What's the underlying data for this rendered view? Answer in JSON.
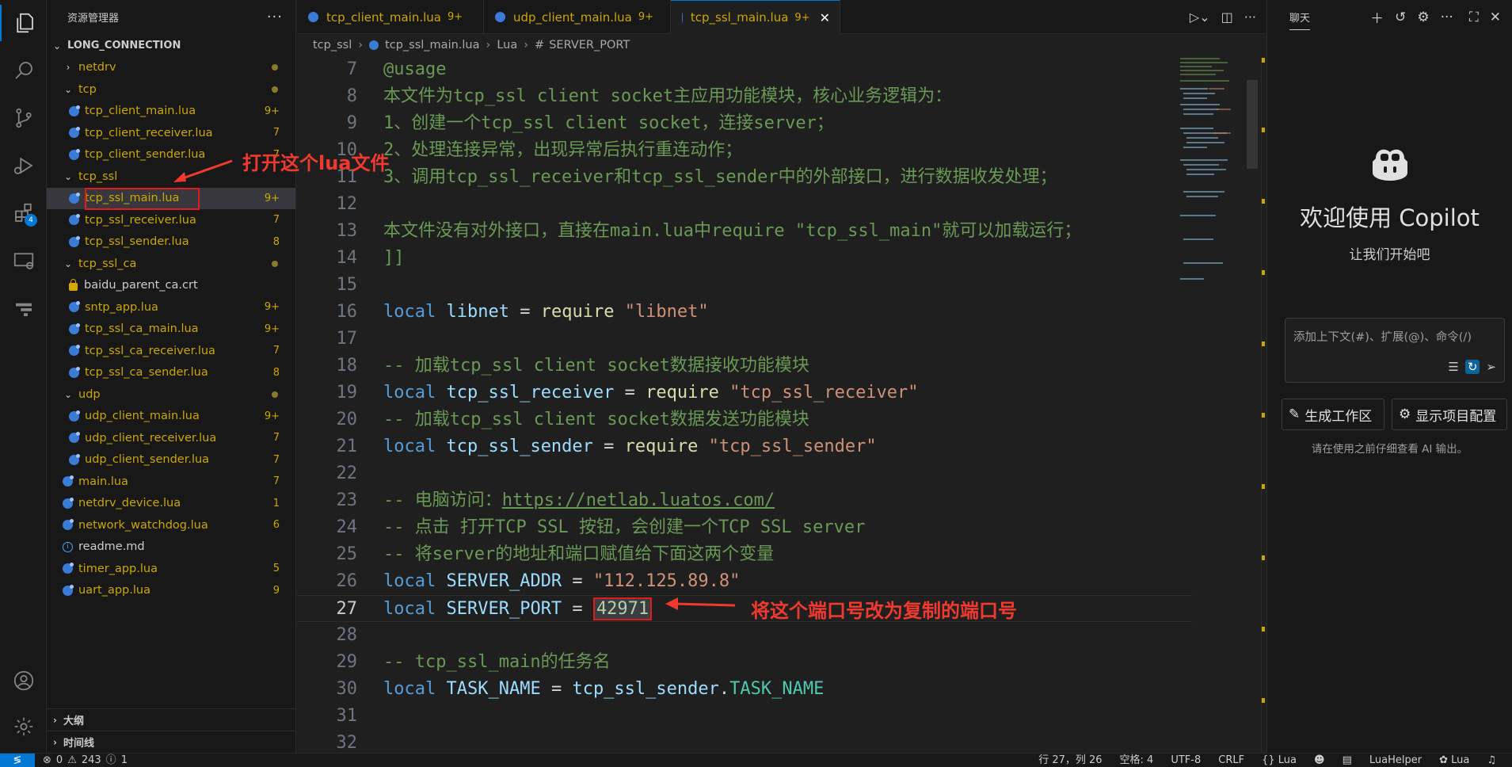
{
  "explorer": {
    "title": "资源管理器",
    "more": "···",
    "root": "LONG_CONNECTION",
    "items": [
      {
        "label": "netdrv",
        "kind": "folder",
        "level": 1,
        "status": "dot"
      },
      {
        "label": "tcp",
        "kind": "folder-open",
        "level": 1,
        "status": "dot"
      },
      {
        "label": "tcp_client_main.lua",
        "kind": "lua",
        "level": 2,
        "status": "9+"
      },
      {
        "label": "tcp_client_receiver.lua",
        "kind": "lua",
        "level": 2,
        "status": "7"
      },
      {
        "label": "tcp_client_sender.lua",
        "kind": "lua",
        "level": 2,
        "status": "7"
      },
      {
        "label": "tcp_ssl",
        "kind": "folder-open",
        "level": 1,
        "status": ""
      },
      {
        "label": "tcp_ssl_main.lua",
        "kind": "lua",
        "level": 2,
        "status": "9+",
        "selected": true
      },
      {
        "label": "tcp_ssl_receiver.lua",
        "kind": "lua",
        "level": 2,
        "status": "7"
      },
      {
        "label": "tcp_ssl_sender.lua",
        "kind": "lua",
        "level": 2,
        "status": "8"
      },
      {
        "label": "tcp_ssl_ca",
        "kind": "folder-open",
        "level": 1,
        "status": "dot"
      },
      {
        "label": "baidu_parent_ca.crt",
        "kind": "crt",
        "level": 2,
        "status": ""
      },
      {
        "label": "sntp_app.lua",
        "kind": "lua",
        "level": 2,
        "status": "9+"
      },
      {
        "label": "tcp_ssl_ca_main.lua",
        "kind": "lua",
        "level": 2,
        "status": "9+"
      },
      {
        "label": "tcp_ssl_ca_receiver.lua",
        "kind": "lua",
        "level": 2,
        "status": "7"
      },
      {
        "label": "tcp_ssl_ca_sender.lua",
        "kind": "lua",
        "level": 2,
        "status": "8"
      },
      {
        "label": "udp",
        "kind": "folder-open",
        "level": 1,
        "status": "dot"
      },
      {
        "label": "udp_client_main.lua",
        "kind": "lua",
        "level": 2,
        "status": "9+"
      },
      {
        "label": "udp_client_receiver.lua",
        "kind": "lua",
        "level": 2,
        "status": "7"
      },
      {
        "label": "udp_client_sender.lua",
        "kind": "lua",
        "level": 2,
        "status": "7"
      },
      {
        "label": "main.lua",
        "kind": "lua",
        "level": 1,
        "status": "7"
      },
      {
        "label": "netdrv_device.lua",
        "kind": "lua",
        "level": 1,
        "status": "1"
      },
      {
        "label": "network_watchdog.lua",
        "kind": "lua",
        "level": 1,
        "status": "6"
      },
      {
        "label": "readme.md",
        "kind": "info",
        "level": 1,
        "status": ""
      },
      {
        "label": "timer_app.lua",
        "kind": "lua",
        "level": 1,
        "status": "5"
      },
      {
        "label": "uart_app.lua",
        "kind": "lua",
        "level": 1,
        "status": "9"
      }
    ],
    "outline": "大纲",
    "timeline": "时间线"
  },
  "activity": {
    "extensions_badge": "4"
  },
  "tabs": [
    {
      "label": "tcp_client_main.lua",
      "status": "9+"
    },
    {
      "label": "udp_client_main.lua",
      "status": "9+"
    },
    {
      "label": "tcp_ssl_main.lua",
      "status": "9+",
      "active": true,
      "close": "✕"
    }
  ],
  "breadcrumb": {
    "folder": "tcp_ssl",
    "file": "tcp_ssl_main.lua",
    "lang": "Lua",
    "symbol_icon": "#",
    "symbol": "SERVER_PORT"
  },
  "editor": {
    "lines": [
      {
        "n": "7",
        "t": [
          [
            "c-comment",
            "@usage"
          ]
        ]
      },
      {
        "n": "8",
        "t": [
          [
            "c-comment",
            "本文件为tcp_ssl client socket主应用功能模块，核心业务逻辑为："
          ]
        ]
      },
      {
        "n": "9",
        "t": [
          [
            "c-comment",
            "1、创建一个tcp_ssl client socket，连接server；"
          ]
        ]
      },
      {
        "n": "10",
        "t": [
          [
            "c-comment",
            "2、处理连接异常，出现异常后执行重连动作；"
          ]
        ]
      },
      {
        "n": "11",
        "t": [
          [
            "c-comment",
            "3、调用tcp_ssl_receiver和tcp_ssl_sender中的外部接口，进行数据收发处理；"
          ]
        ]
      },
      {
        "n": "12",
        "t": []
      },
      {
        "n": "13",
        "t": [
          [
            "c-comment",
            "本文件没有对外接口，直接在main.lua中require \"tcp_ssl_main\"就可以加载运行；"
          ]
        ]
      },
      {
        "n": "14",
        "t": [
          [
            "c-comment",
            "]]"
          ]
        ]
      },
      {
        "n": "15",
        "t": []
      },
      {
        "n": "16",
        "t": [
          [
            "c-kw",
            "local "
          ],
          [
            "c-var",
            "libnet"
          ],
          [
            "c-op",
            " = "
          ],
          [
            "c-fn",
            "require"
          ],
          [
            "c-op",
            " "
          ],
          [
            "c-str",
            "\"libnet\""
          ]
        ]
      },
      {
        "n": "17",
        "t": []
      },
      {
        "n": "18",
        "t": [
          [
            "c-comment",
            "-- 加载tcp_ssl client socket数据接收功能模块"
          ]
        ]
      },
      {
        "n": "19",
        "t": [
          [
            "c-kw",
            "local "
          ],
          [
            "c-var",
            "tcp_ssl_receiver"
          ],
          [
            "c-op",
            " = "
          ],
          [
            "c-fn",
            "require"
          ],
          [
            "c-op",
            " "
          ],
          [
            "c-str",
            "\"tcp_ssl_receiver\""
          ]
        ]
      },
      {
        "n": "20",
        "t": [
          [
            "c-comment",
            "-- 加载tcp_ssl client socket数据发送功能模块"
          ]
        ]
      },
      {
        "n": "21",
        "t": [
          [
            "c-kw",
            "local "
          ],
          [
            "c-var",
            "tcp_ssl_sender"
          ],
          [
            "c-op",
            " = "
          ],
          [
            "c-fn",
            "require"
          ],
          [
            "c-op",
            " "
          ],
          [
            "c-str",
            "\"tcp_ssl_sender\""
          ]
        ]
      },
      {
        "n": "22",
        "t": []
      },
      {
        "n": "23",
        "t": [
          [
            "c-comment",
            "-- 电脑访问："
          ],
          [
            "c-url",
            "https://netlab.luatos.com/"
          ]
        ]
      },
      {
        "n": "24",
        "t": [
          [
            "c-comment",
            "-- 点击 打开TCP SSL 按钮，会创建一个TCP SSL server"
          ]
        ]
      },
      {
        "n": "25",
        "t": [
          [
            "c-comment",
            "-- 将server的地址和端口赋值给下面这两个变量"
          ]
        ]
      },
      {
        "n": "26",
        "t": [
          [
            "c-kw",
            "local "
          ],
          [
            "c-var",
            "SERVER_ADDR"
          ],
          [
            "c-op",
            " = "
          ],
          [
            "c-str",
            "\"112.125.89.8\""
          ]
        ]
      },
      {
        "n": "27",
        "cur": true,
        "t": [
          [
            "c-kw",
            "local "
          ],
          [
            "c-var",
            "SERVER_PORT"
          ],
          [
            "c-op",
            " = "
          ],
          [
            "c-num num-box",
            "42971"
          ]
        ]
      },
      {
        "n": "28",
        "t": []
      },
      {
        "n": "29",
        "t": [
          [
            "c-comment",
            "-- tcp_ssl_main的任务名"
          ]
        ]
      },
      {
        "n": "30",
        "t": [
          [
            "c-kw",
            "local "
          ],
          [
            "c-var",
            "TASK_NAME"
          ],
          [
            "c-op",
            " = "
          ],
          [
            "c-var",
            "tcp_ssl_sender"
          ],
          [
            "c-op",
            "."
          ],
          [
            "c-field",
            "TASK_NAME"
          ]
        ]
      },
      {
        "n": "31",
        "t": []
      },
      {
        "n": "32",
        "t": []
      }
    ]
  },
  "annotations": {
    "open_file": "打开这个lua文件",
    "change_port": "将这个端口号改为复制的端口号"
  },
  "copilot": {
    "tab": "聊天",
    "title": "欢迎使用 Copilot",
    "subtitle": "让我们开始吧",
    "input_placeholder": "添加上下文(#)、扩展(@)、命令(/)",
    "btn_workspace": "生成工作区",
    "btn_config": "显示项目配置",
    "note": "请在使用之前仔细查看 AI 输出。"
  },
  "statusbar": {
    "remote": "≶",
    "errors": "0",
    "warnings": "243",
    "info": "1",
    "position": "行 27，列 26",
    "spaces": "空格: 4",
    "encoding": "UTF-8",
    "eol": "CRLF",
    "language": "Lua",
    "helper": "LuaHelper",
    "lang_mode": "Lua"
  },
  "colors": {
    "accent": "#0078d4",
    "annotation": "#f03a2f",
    "warning": "#cca700"
  }
}
